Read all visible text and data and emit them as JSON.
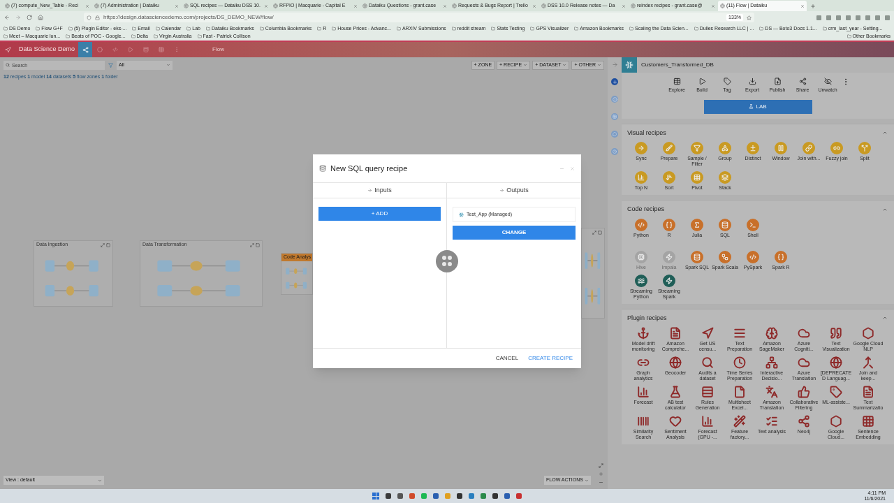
{
  "browser": {
    "tabs": [
      {
        "label": "(7) compute_New_Table - Reci",
        "selected": false
      },
      {
        "label": "(7) Administration | Dataiku",
        "selected": false
      },
      {
        "label": "SQL recipes — Dataiku DSS 10.",
        "selected": false
      },
      {
        "label": "RFPIO | Macquarie - Capital E",
        "selected": false
      },
      {
        "label": "Dataiku Questions - grant.case",
        "selected": false
      },
      {
        "label": "Requests & Bugs Report | Trello",
        "selected": false
      },
      {
        "label": "DSS 10.0 Release notes — Da",
        "selected": false
      },
      {
        "label": "reindex recipes - grant.case@",
        "selected": false
      },
      {
        "label": "(11) Flow | Dataiku",
        "selected": true
      }
    ],
    "url": "https://design.datasciencedemo.com/projects/DS_DEMO_NEW/flow/",
    "zoom": "133%",
    "bookmarks": [
      "DS Demo",
      "Flow G+F",
      "(5) Plugin Editor - eks-...",
      "Email",
      "Calendar",
      "Lab",
      "Dataiku Bookmarks",
      "Columbia Bookmarks",
      "R",
      "House Prices - Advanc...",
      "ARXIV Submissions",
      "reddit stream",
      "Stats Testing",
      "GPS Visualizer",
      "Amazon Bookmarks",
      "Scaling the Data Scien...",
      "Dulles Research LLC | ...",
      "DS — Boto3 Docs 1.1...",
      "crm_last_year - Setting...",
      "Meet – Macquarie lun...",
      "Beats of POC - Google...",
      "Delta",
      "Virgin Australia",
      "Fast - Patrick Collison"
    ],
    "other_bookmarks": "Other Bookmarks"
  },
  "app": {
    "project": "Data Science Demo",
    "page": "Flow"
  },
  "toolbar": {
    "search_placeholder": "Search",
    "filter": "All",
    "summary": "**12** recipes **1** model **14** datasets **5** flow zones **1** folder",
    "actions": [
      {
        "label": "+ ZONE",
        "dropdown": false
      },
      {
        "label": "+ RECIPE",
        "dropdown": true
      },
      {
        "label": "+ DATASET",
        "dropdown": true
      },
      {
        "label": "+ OTHER",
        "dropdown": true
      }
    ]
  },
  "zones": [
    {
      "kind": "titled",
      "title": "Data Ingestion"
    },
    {
      "kind": "titled",
      "title": "Data Transformation"
    },
    {
      "kind": "highlighted",
      "title": "Code Analys"
    },
    {
      "kind": "untitled"
    }
  ],
  "view": "View : default",
  "flow_actions": "FLOW ACTIONS",
  "modal": {
    "title": "New SQL query recipe",
    "inputs_heading": "Inputs",
    "add_button": "+ ADD",
    "outputs_heading": "Outputs",
    "output": "Test_App (Managed)",
    "change_button": "CHANGE",
    "cancel": "CANCEL",
    "create": "CREATE RECIPE"
  },
  "panel": {
    "dataset": "Customers_Transformed_DB",
    "actions": [
      "Explore",
      "Build",
      "Tag",
      "Export",
      "Publish",
      "Share",
      "Unwatch"
    ],
    "lab": "LAB",
    "sections": [
      {
        "kind": "visual",
        "title": "Visual recipes",
        "expanded": true,
        "rows": [
          [
            {
              "label": "Sync"
            },
            {
              "label": "Prepare"
            },
            {
              "label": "Sample / Filter"
            },
            {
              "label": "Group"
            },
            {
              "label": "Distinct"
            },
            {
              "label": "Window"
            },
            {
              "label": "Join with..."
            },
            {
              "label": "Fuzzy join"
            },
            {
              "label": "Split"
            }
          ],
          [
            {
              "label": "Top N"
            },
            {
              "label": "Sort"
            },
            {
              "label": "Pivot"
            },
            {
              "label": "Stack"
            }
          ]
        ]
      },
      {
        "kind": "code",
        "title": "Code recipes",
        "expanded": true,
        "rows": [
          [
            {
              "label": "Python",
              "color": "#c8702a",
              "disabled": false
            },
            {
              "label": "R",
              "color": "#c8702a",
              "disabled": false
            },
            {
              "label": "Julia",
              "color": "#c8702a",
              "disabled": false
            },
            {
              "label": "SQL",
              "color": "#c8702a",
              "disabled": false
            },
            {
              "label": "Shell",
              "color": "#c8702a",
              "disabled": false
            }
          ],
          [
            {
              "label": "Hive",
              "color": "#a4a4a4",
              "disabled": true
            },
            {
              "label": "Impala",
              "color": "#a4a4a4",
              "disabled": true
            },
            {
              "label": "Spark SQL",
              "color": "#c8702a",
              "disabled": false
            },
            {
              "label": "Spark Scala",
              "color": "#c8702a",
              "disabled": false
            },
            {
              "label": "PySpark",
              "color": "#c8702a",
              "disabled": false
            },
            {
              "label": "Spark R",
              "color": "#c8702a",
              "disabled": false
            }
          ],
          [
            {
              "label": "Streaming Python",
              "color": "#1f5e57",
              "disabled": false
            },
            {
              "label": "Streaming Spark",
              "color": "#1f5e57",
              "disabled": false
            }
          ]
        ]
      },
      {
        "kind": "plugin",
        "title": "Plugin recipes",
        "expanded": true,
        "rows": [
          [
            {
              "label": "Model drift monitoring"
            },
            {
              "label": "Amazon Comprehe..."
            },
            {
              "label": "Get US censu..."
            },
            {
              "label": "Text Preparation"
            },
            {
              "label": "Amazon SageMaker"
            },
            {
              "label": "Azure Cogniti..."
            },
            {
              "label": "Text Visualization"
            },
            {
              "label": "Google Cloud NLP"
            }
          ],
          [
            {
              "label": "Graph analytics"
            },
            {
              "label": "Geocoder"
            },
            {
              "label": "Audits a dataset"
            },
            {
              "label": "Time Series Preparation"
            },
            {
              "label": "Interactive Decisio..."
            },
            {
              "label": "Azure Translation"
            },
            {
              "label": "[DEPRECATED Languag..."
            },
            {
              "label": "Join and keep..."
            }
          ],
          [
            {
              "label": "Forecast"
            },
            {
              "label": "AB test calculator"
            },
            {
              "label": "Rules Generation"
            },
            {
              "label": "Multisheet Excel..."
            },
            {
              "label": "Amazon Translation"
            },
            {
              "label": "Collaborative Filtering"
            },
            {
              "label": "ML-assiste..."
            },
            {
              "label": "Text Summarizatio"
            }
          ],
          [
            {
              "label": "Similarity Search"
            },
            {
              "label": "Sentiment Analysis"
            },
            {
              "label": "Forecast (GPU -..."
            },
            {
              "label": "Feature factory..."
            },
            {
              "label": "Text analysis"
            },
            {
              "label": "Neo4j"
            },
            {
              "label": "Google Cloud..."
            },
            {
              "label": "Sentence Embedding"
            }
          ]
        ]
      }
    ]
  },
  "taskbar": {
    "time": "4:11 PM",
    "date": "11/6/2021"
  }
}
